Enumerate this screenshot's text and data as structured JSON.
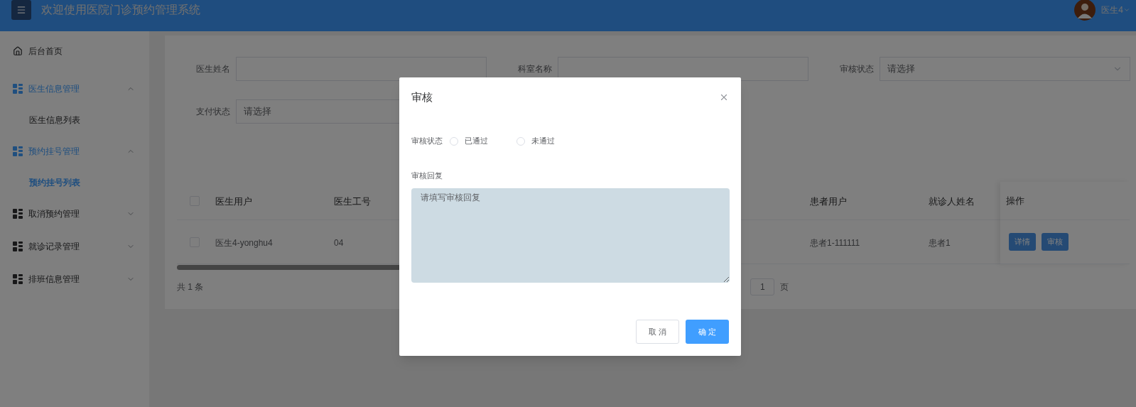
{
  "header": {
    "title": "欢迎使用医院门诊预约管理系统",
    "user": "医生4"
  },
  "sidebar": {
    "items": [
      {
        "label": "后台首页",
        "kind": "link"
      },
      {
        "label": "医生信息管理",
        "kind": "menu",
        "expanded": true,
        "children": [
          {
            "label": "医生信息列表",
            "selected": false
          }
        ]
      },
      {
        "label": "预约挂号管理",
        "kind": "menu",
        "expanded": true,
        "children": [
          {
            "label": "预约挂号列表",
            "selected": true
          }
        ]
      },
      {
        "label": "取消预约管理",
        "kind": "menu",
        "expanded": false
      },
      {
        "label": "就诊记录管理",
        "kind": "menu",
        "expanded": false
      },
      {
        "label": "排班信息管理",
        "kind": "menu",
        "expanded": false
      }
    ]
  },
  "filters": [
    {
      "label": "医生姓名",
      "kind": "input"
    },
    {
      "label": "科室名称",
      "kind": "input"
    },
    {
      "label": "审核状态",
      "kind": "select",
      "placeholder": "请选择",
      "caret": true
    },
    {
      "label": "支付状态",
      "kind": "select",
      "placeholder": "请选择"
    }
  ],
  "table": {
    "checked": false,
    "columns": [
      "医生用户",
      "医生工号",
      "患者用户",
      "就诊人姓名",
      "操作"
    ],
    "rows": [
      {
        "checked": false,
        "cells": [
          "医生4-yonghu4",
          "04",
          "患者1-111111",
          "患者1"
        ],
        "actions": [
          "详情",
          "审核"
        ]
      }
    ]
  },
  "pagination": {
    "total": "共 1 条",
    "page": "1",
    "page_suffix": "页"
  },
  "dialog": {
    "title": "审核",
    "fields": [
      {
        "label": "审核状态",
        "kind": "radio",
        "options": [
          {
            "label": "已通过",
            "selected": false
          },
          {
            "label": "未通过",
            "selected": false
          }
        ]
      },
      {
        "label": "审核回复",
        "kind": "textarea",
        "placeholder": "请填写审核回复"
      }
    ],
    "buttons": [
      {
        "label": "取 消",
        "kind": "default"
      },
      {
        "label": "确 定",
        "kind": "primary"
      }
    ]
  }
}
